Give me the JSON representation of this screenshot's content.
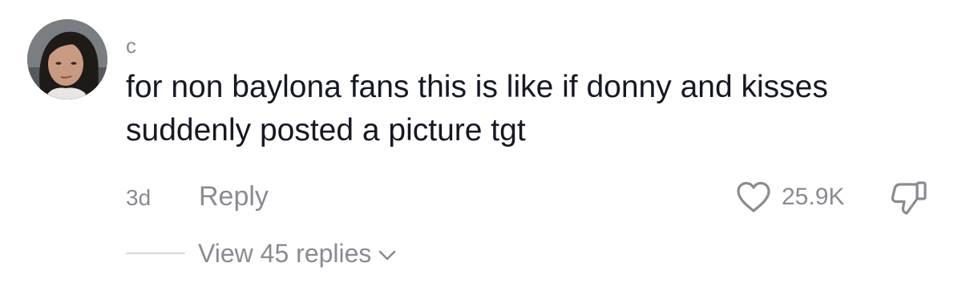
{
  "comment": {
    "username": "c",
    "text": "for non baylona fans this is like if donny and kisses\nsuddenly posted a picture tgt",
    "timestamp": "3d",
    "reply_label": "Reply",
    "like_count": "25.9K",
    "view_replies_label": "View 45 replies"
  },
  "icons": {
    "like": "heart-outline-icon",
    "dislike": "thumbs-down-outline-icon",
    "expand": "chevron-down-icon"
  },
  "colors": {
    "text_primary": "#161823",
    "text_secondary": "#8a8b91",
    "divider": "#d8d8db"
  }
}
